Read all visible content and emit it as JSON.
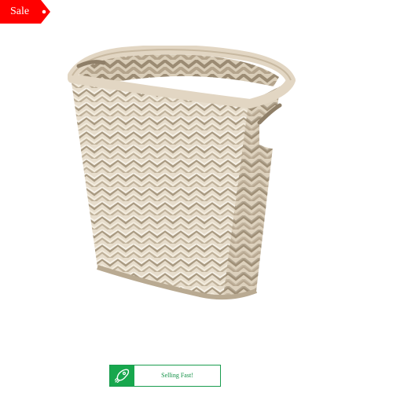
{
  "sale_badge": {
    "label": "Sale",
    "color": "#ff0000"
  },
  "product": {
    "image_icon": "wicker-basket-image"
  },
  "selling_badge": {
    "label": "Selling Fast!",
    "icon": "rocket-icon",
    "accent_color": "#17a74d"
  }
}
